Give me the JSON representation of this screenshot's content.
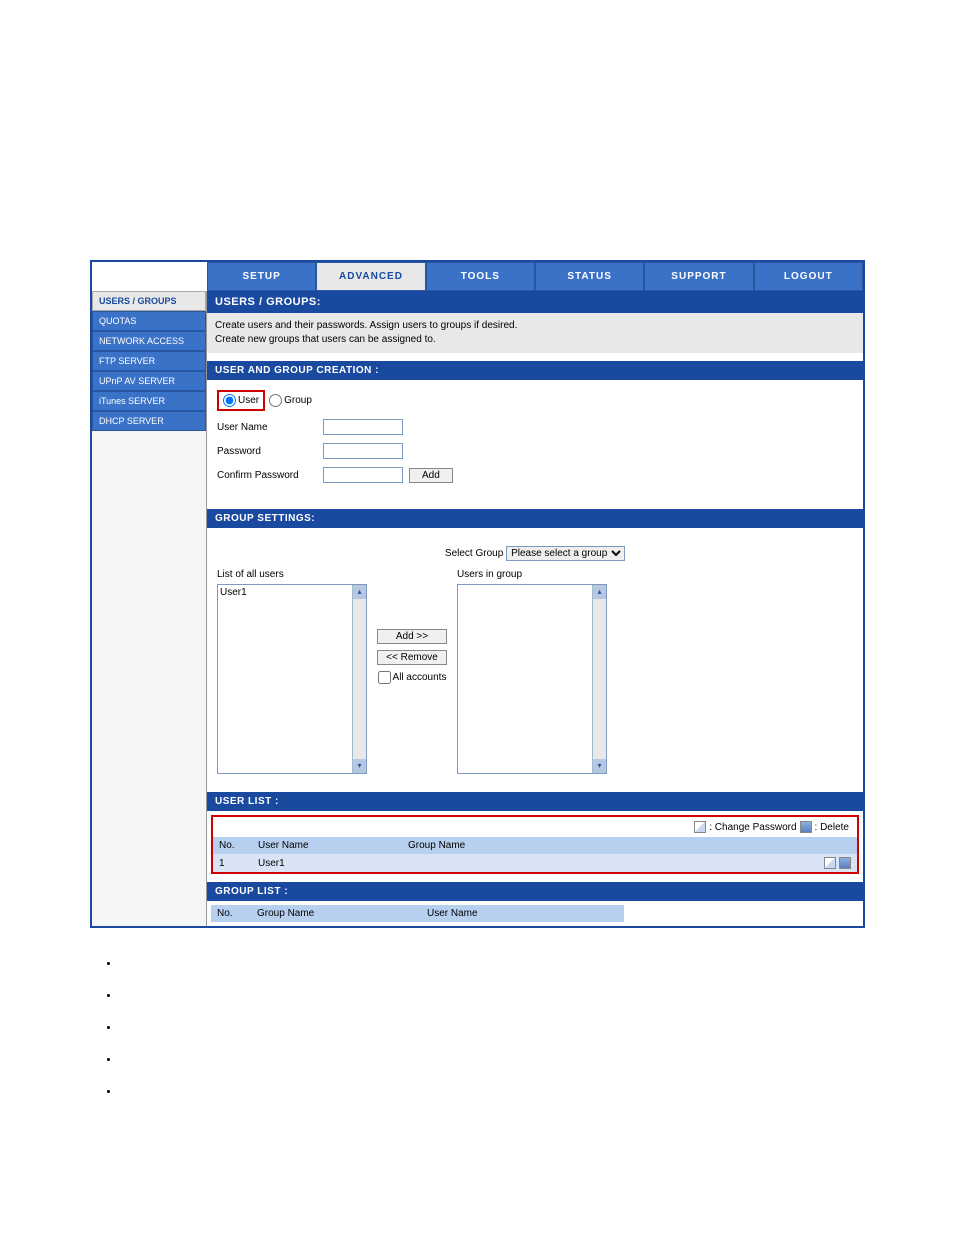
{
  "topnav": {
    "tabs": [
      {
        "label": "SETUP"
      },
      {
        "label": "ADVANCED"
      },
      {
        "label": "TOOLS"
      },
      {
        "label": "STATUS"
      },
      {
        "label": "SUPPORT"
      },
      {
        "label": "LOGOUT"
      }
    ]
  },
  "sidebar": {
    "items": [
      {
        "label": "USERS / GROUPS"
      },
      {
        "label": "QUOTAS"
      },
      {
        "label": "NETWORK ACCESS"
      },
      {
        "label": "FTP SERVER"
      },
      {
        "label": "UPnP AV SERVER"
      },
      {
        "label": "iTunes SERVER"
      },
      {
        "label": "DHCP SERVER"
      }
    ]
  },
  "panel": {
    "title": "USERS / GROUPS:",
    "desc1": "Create users and their passwords. Assign users to groups if desired.",
    "desc2": "Create new groups that users can be assigned to."
  },
  "creation": {
    "header": "USER AND GROUP CREATION :",
    "radio_user": "User",
    "radio_group": "Group",
    "user_name_label": "User Name",
    "password_label": "Password",
    "confirm_label": "Confirm Password",
    "add_btn": "Add",
    "user_name_value": "",
    "password_value": "",
    "confirm_value": ""
  },
  "group_settings": {
    "header": "GROUP SETTINGS:",
    "select_label": "Select Group",
    "select_value": "Please select a group",
    "list_all_label": "List of all users",
    "users_in_group_label": "Users in group",
    "all_users": [
      "User1"
    ],
    "add_btn": "Add >>",
    "remove_btn": "<< Remove",
    "all_accounts_label": "All accounts"
  },
  "user_list": {
    "header": "USER LIST :",
    "legend_change": ": Change Password",
    "legend_delete": ": Delete",
    "col_no": "No.",
    "col_user": "User Name",
    "col_group": "Group Name",
    "rows": [
      {
        "no": "1",
        "user": "User1",
        "group": ""
      }
    ]
  },
  "group_list": {
    "header": "GROUP LIST :",
    "col_no": "No.",
    "col_group": "Group Name",
    "col_user": "User Name"
  }
}
